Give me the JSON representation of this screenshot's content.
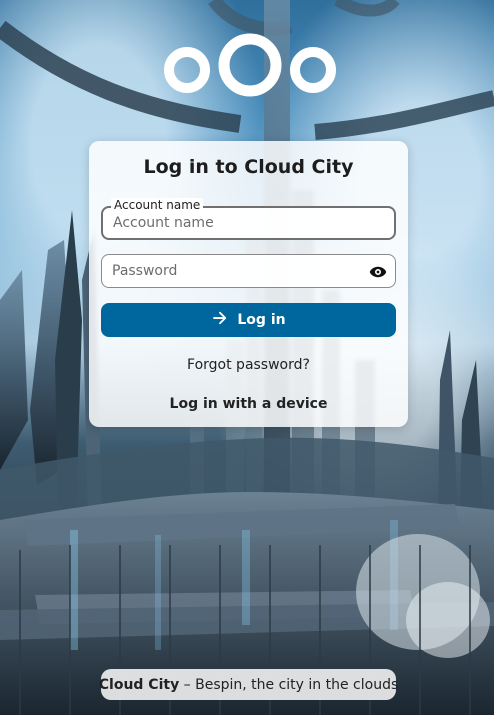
{
  "brand": {
    "logo_icon": "nextcloud-logo-icon",
    "accent_color": "#00679e"
  },
  "login": {
    "title": "Log in to Cloud City",
    "account_label": "Account name",
    "account_placeholder": "Account name",
    "account_value": "",
    "password_placeholder": "Password",
    "password_value": "",
    "password_toggle_icon": "eye-icon",
    "submit_icon": "arrow-right-icon",
    "submit_label": "Log in",
    "forgot_password_label": "Forgot password?",
    "device_login_label": "Log in with a device"
  },
  "footer": {
    "name": "Cloud City",
    "separator": "–",
    "slogan": "Bespin, the city in the clouds"
  }
}
